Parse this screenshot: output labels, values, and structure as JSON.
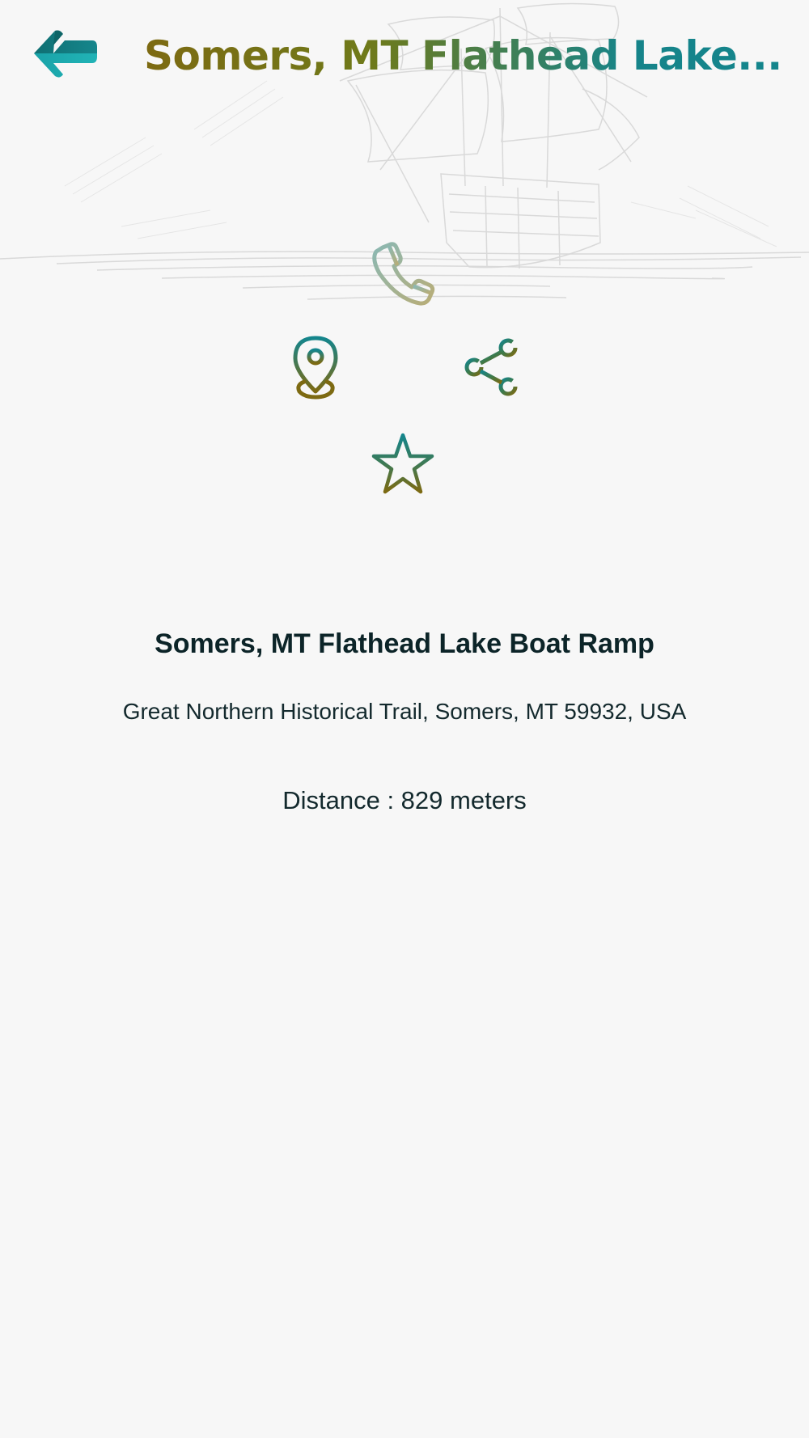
{
  "header": {
    "title": "Somers, MT Flathead Lake..."
  },
  "icons": {
    "background": "sailing-ship-sketch",
    "back": "back-arrow-icon",
    "call": "phone-icon",
    "location": "map-pin-icon",
    "share": "share-icon",
    "favorite": "star-icon"
  },
  "place": {
    "name": "Somers, MT Flathead Lake Boat Ramp",
    "address": "Great Northern Historical Trail, Somers, MT 59932, USA",
    "distance": "Distance : 829 meters"
  },
  "colors": {
    "background": "#f7f7f7",
    "olive": "#7d6a12",
    "teal": "#14858c",
    "text": "#0f2529"
  }
}
